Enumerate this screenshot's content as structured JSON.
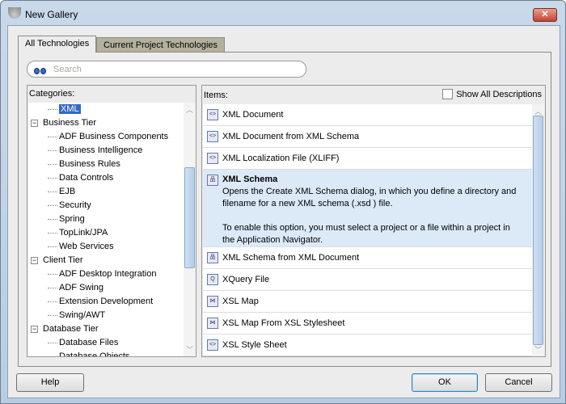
{
  "window": {
    "title": "New Gallery",
    "close_label": "✕"
  },
  "tabs": [
    {
      "label": "All Technologies",
      "active": true
    },
    {
      "label": "Current Project Technologies",
      "active": false
    }
  ],
  "search": {
    "placeholder": "Search"
  },
  "categories": {
    "header": "Categories:",
    "items": [
      {
        "label": "XML",
        "level": 2,
        "selected": true
      },
      {
        "label": "Business Tier",
        "level": 1,
        "expanded": true
      },
      {
        "label": "ADF Business Components",
        "level": 2
      },
      {
        "label": "Business Intelligence",
        "level": 2
      },
      {
        "label": "Business Rules",
        "level": 2
      },
      {
        "label": "Data Controls",
        "level": 2
      },
      {
        "label": "EJB",
        "level": 2
      },
      {
        "label": "Security",
        "level": 2
      },
      {
        "label": "Spring",
        "level": 2
      },
      {
        "label": "TopLink/JPA",
        "level": 2
      },
      {
        "label": "Web Services",
        "level": 2
      },
      {
        "label": "Client Tier",
        "level": 1,
        "expanded": true
      },
      {
        "label": "ADF Desktop Integration",
        "level": 2
      },
      {
        "label": "ADF Swing",
        "level": 2
      },
      {
        "label": "Extension Development",
        "level": 2
      },
      {
        "label": "Swing/AWT",
        "level": 2
      },
      {
        "label": "Database Tier",
        "level": 1,
        "expanded": true
      },
      {
        "label": "Database Files",
        "level": 2
      },
      {
        "label": "Database Objects",
        "level": 2
      }
    ]
  },
  "items": {
    "header": "Items:",
    "show_all_label": "Show All Descriptions",
    "list": [
      {
        "label": "XML Document",
        "icon": "xml-document-icon"
      },
      {
        "label": "XML Document from XML Schema",
        "icon": "xml-document-icon"
      },
      {
        "label": "XML Localization File (XLIFF)",
        "icon": "xml-document-icon"
      },
      {
        "label": "XML Schema",
        "icon": "xml-schema-icon",
        "selected": true,
        "description": "Opens the Create XML Schema dialog, in which you define a directory and\nfilename for a new XML schema (.xsd ) file.\n\nTo enable this option, you must select a project or a file within a project in\nthe Application Navigator."
      },
      {
        "label": "XML Schema from XML Document",
        "icon": "xml-schema-icon"
      },
      {
        "label": "XQuery File",
        "icon": "xquery-file-icon"
      },
      {
        "label": "XSL Map",
        "icon": "xsl-map-icon"
      },
      {
        "label": "XSL Map From XSL Stylesheet",
        "icon": "xsl-map-icon"
      },
      {
        "label": "XSL Style Sheet",
        "icon": "xml-document-icon"
      }
    ]
  },
  "buttons": {
    "help": "Help",
    "ok": "OK",
    "cancel": "Cancel"
  }
}
